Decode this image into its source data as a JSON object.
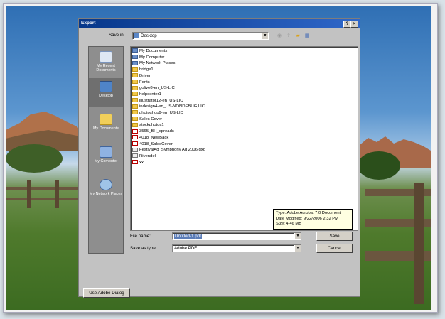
{
  "dialog": {
    "title": "Export",
    "help_button": "?",
    "close_button": "×",
    "save_in_label": "Save in:",
    "save_in_value": "Desktop",
    "file_name_label": "File name:",
    "file_name_value": "Untitled-1.pdf",
    "save_as_type_label": "Save as type:",
    "save_as_type_value": "Adobe PDF",
    "save_button": "Save",
    "cancel_button": "Cancel",
    "adobe_dialog_button": "Use Adobe Dialog"
  },
  "places": [
    {
      "label": "My Recent Documents",
      "icon": "recent-documents-icon"
    },
    {
      "label": "Desktop",
      "icon": "desktop-icon"
    },
    {
      "label": "My Documents",
      "icon": "my-documents-icon"
    },
    {
      "label": "My Computer",
      "icon": "my-computer-icon"
    },
    {
      "label": "My Network Places",
      "icon": "network-places-icon"
    }
  ],
  "files": [
    {
      "name": "My Documents",
      "kind": "sys"
    },
    {
      "name": "My Computer",
      "kind": "sys"
    },
    {
      "name": "My Network Places",
      "kind": "sys"
    },
    {
      "name": "bridge1",
      "kind": "folder"
    },
    {
      "name": "Driver",
      "kind": "folder"
    },
    {
      "name": "Fonts",
      "kind": "folder"
    },
    {
      "name": "golive8-en_US-LIC",
      "kind": "folder"
    },
    {
      "name": "helpcenter1",
      "kind": "folder"
    },
    {
      "name": "illustrator12-en_US-LIC",
      "kind": "folder"
    },
    {
      "name": "indesign4-en_US-NONDEBUG,LIC",
      "kind": "folder"
    },
    {
      "name": "photoshop9-en_US-LIC",
      "kind": "folder"
    },
    {
      "name": "Sales Cover",
      "kind": "folder"
    },
    {
      "name": "stockphotos1",
      "kind": "folder"
    },
    {
      "name": "3565_BH_spreads",
      "kind": "pdf"
    },
    {
      "name": "4018_NewBack",
      "kind": "pdf"
    },
    {
      "name": "4018_SalesCover",
      "kind": "pdf"
    },
    {
      "name": "FestivalAd_Symphony Ad 2006.qxd",
      "kind": "gen"
    },
    {
      "name": "Rivendell",
      "kind": "gen"
    },
    {
      "name": "xx",
      "kind": "pdf"
    }
  ],
  "tooltip": {
    "line1": "Type: Adobe Acrobat 7.0 Document",
    "line2": "Date Modified: 9/22/2006 2:32 PM",
    "line3": "Size: 4.46 MB"
  }
}
